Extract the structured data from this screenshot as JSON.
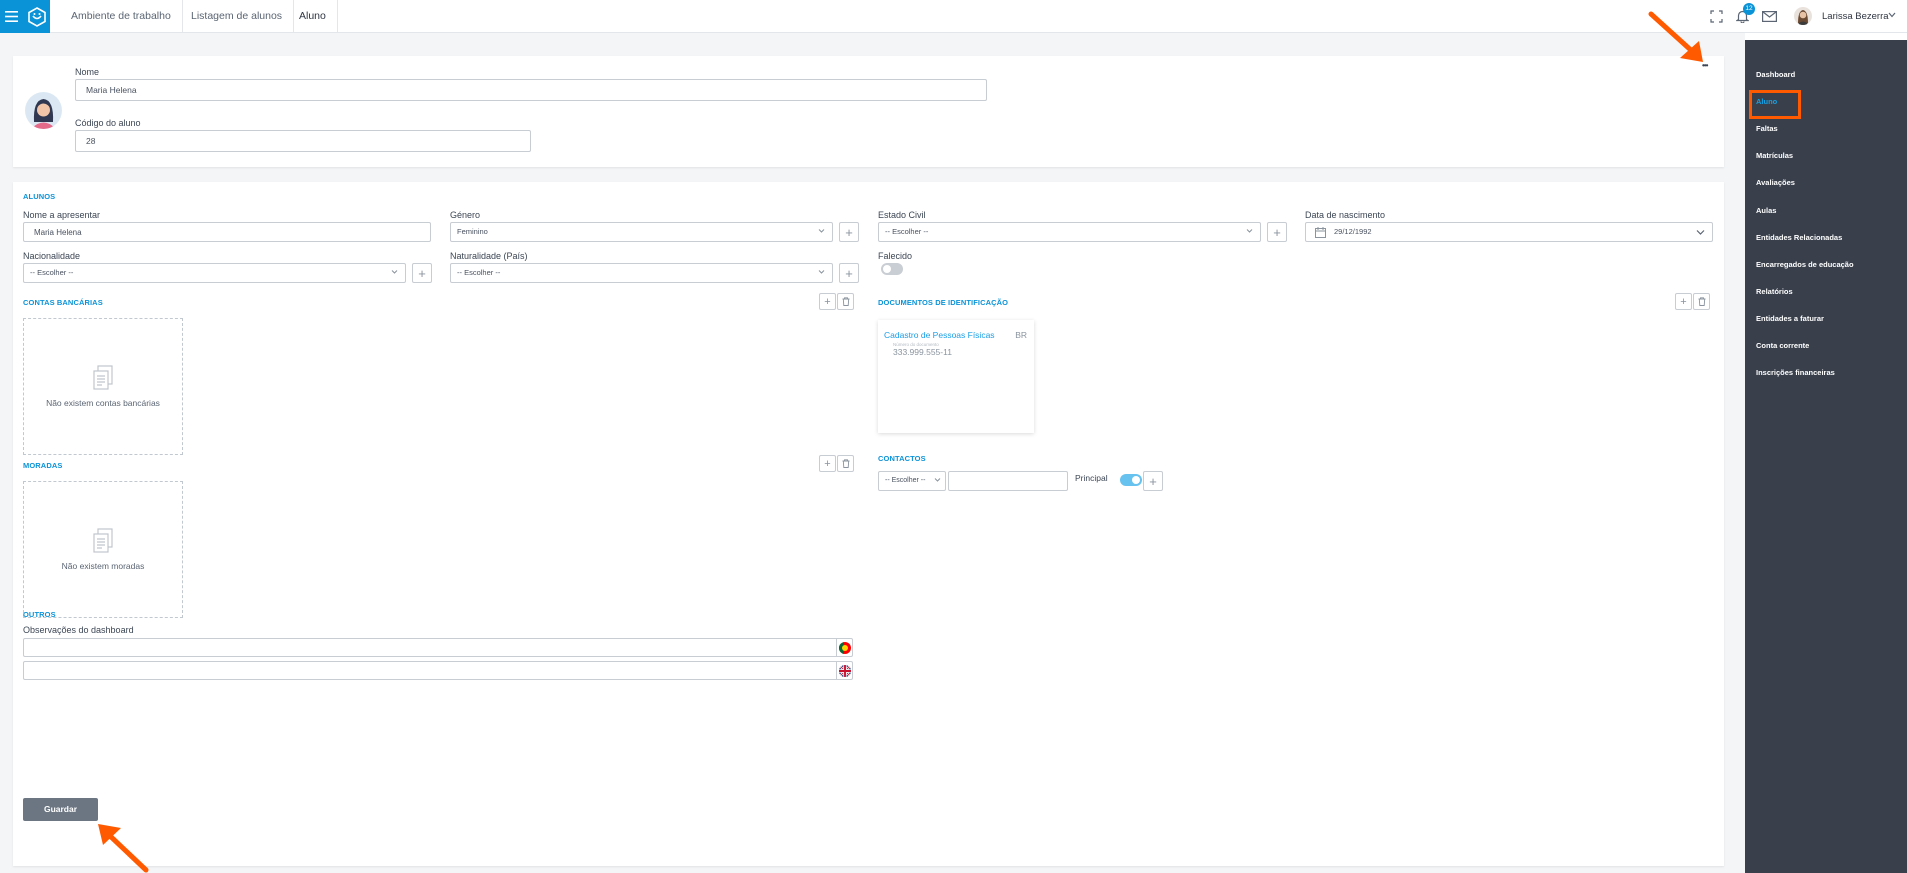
{
  "header": {
    "breadcrumbs": [
      "Ambiente de trabalho",
      "Listagem de alunos",
      "Aluno"
    ],
    "notification_count": "12",
    "user_name": "Larissa Bezerra"
  },
  "profile": {
    "name_label": "Nome",
    "name_value": "Maria Helena",
    "code_label": "Código do aluno",
    "code_value": "28",
    "more_label": "•••"
  },
  "alunos": {
    "title": "ALUNOS",
    "display_name_label": "Nome a apresentar",
    "display_name_value": "Maria Helena",
    "gender_label": "Género",
    "gender_value": "Feminino",
    "civil_label": "Estado Civil",
    "civil_value": "-- Escolher --",
    "birth_label": "Data de nascimento",
    "birth_value": "29/12/1992",
    "nationality_label": "Nacionalidade",
    "nationality_value": "-- Escolher --",
    "naturality_label": "Naturalidade (País)",
    "naturality_value": "-- Escolher --",
    "deceased_label": "Falecido"
  },
  "bank": {
    "title": "CONTAS BANCÁRIAS",
    "empty": "Não existem contas bancárias"
  },
  "docs": {
    "title": "DOCUMENTOS DE IDENTIFICAÇÃO",
    "card_title": "Cadastro de Pessoas Físicas",
    "card_country": "BR",
    "card_sublabel": "Número do documento",
    "card_number": "333.999.555-11"
  },
  "moradas": {
    "title": "MORADAS",
    "empty": "Não existem moradas"
  },
  "contacts": {
    "title": "CONTACTOS",
    "type_value": "-- Escolher --",
    "principal_label": "Principal"
  },
  "outros": {
    "title": "OUTROS",
    "notes_label": "Observações do dashboard"
  },
  "save_label": "Guardar",
  "sidebar": {
    "items": [
      {
        "label": "Dashboard"
      },
      {
        "label": "Aluno"
      },
      {
        "label": "Faltas"
      },
      {
        "label": "Matrículas"
      },
      {
        "label": "Avaliações"
      },
      {
        "label": "Aulas"
      },
      {
        "label": "Entidades Relacionadas"
      },
      {
        "label": "Encarregados de educação"
      },
      {
        "label": "Relatórios"
      },
      {
        "label": "Entidades a faturar"
      },
      {
        "label": "Conta corrente"
      },
      {
        "label": "Inscrições financeiras"
      }
    ]
  },
  "colors": {
    "brand": "#0b93d8",
    "sidebar_bg": "#39404c",
    "annotation": "#ff5a00",
    "save_button": "#6c7682"
  }
}
